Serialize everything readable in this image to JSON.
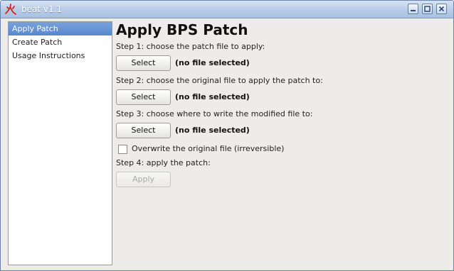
{
  "window": {
    "title": "beat v1.1"
  },
  "sidebar": {
    "items": [
      {
        "label": "Apply Patch",
        "active": true
      },
      {
        "label": "Create Patch",
        "active": false
      },
      {
        "label": "Usage Instructions",
        "active": false
      }
    ]
  },
  "main": {
    "heading": "Apply BPS Patch",
    "step1": "Step 1: choose the patch file to apply:",
    "step2": "Step 2: choose the original file to apply the patch to:",
    "step3": "Step 3: choose where to write the modified file to:",
    "step4": "Step 4: apply the patch:",
    "select_label": "Select",
    "no_file": "(no file selected)",
    "overwrite_label": "Overwrite the original file (irreversible)",
    "overwrite_checked": false,
    "apply_label": "Apply",
    "apply_enabled": false
  },
  "colors": {
    "accent": "#5887cf",
    "titlebar": "#b7cbe7",
    "app_icon": "#d62020"
  },
  "icons": [
    "app-icon",
    "minimize-icon",
    "maximize-icon",
    "close-icon"
  ]
}
